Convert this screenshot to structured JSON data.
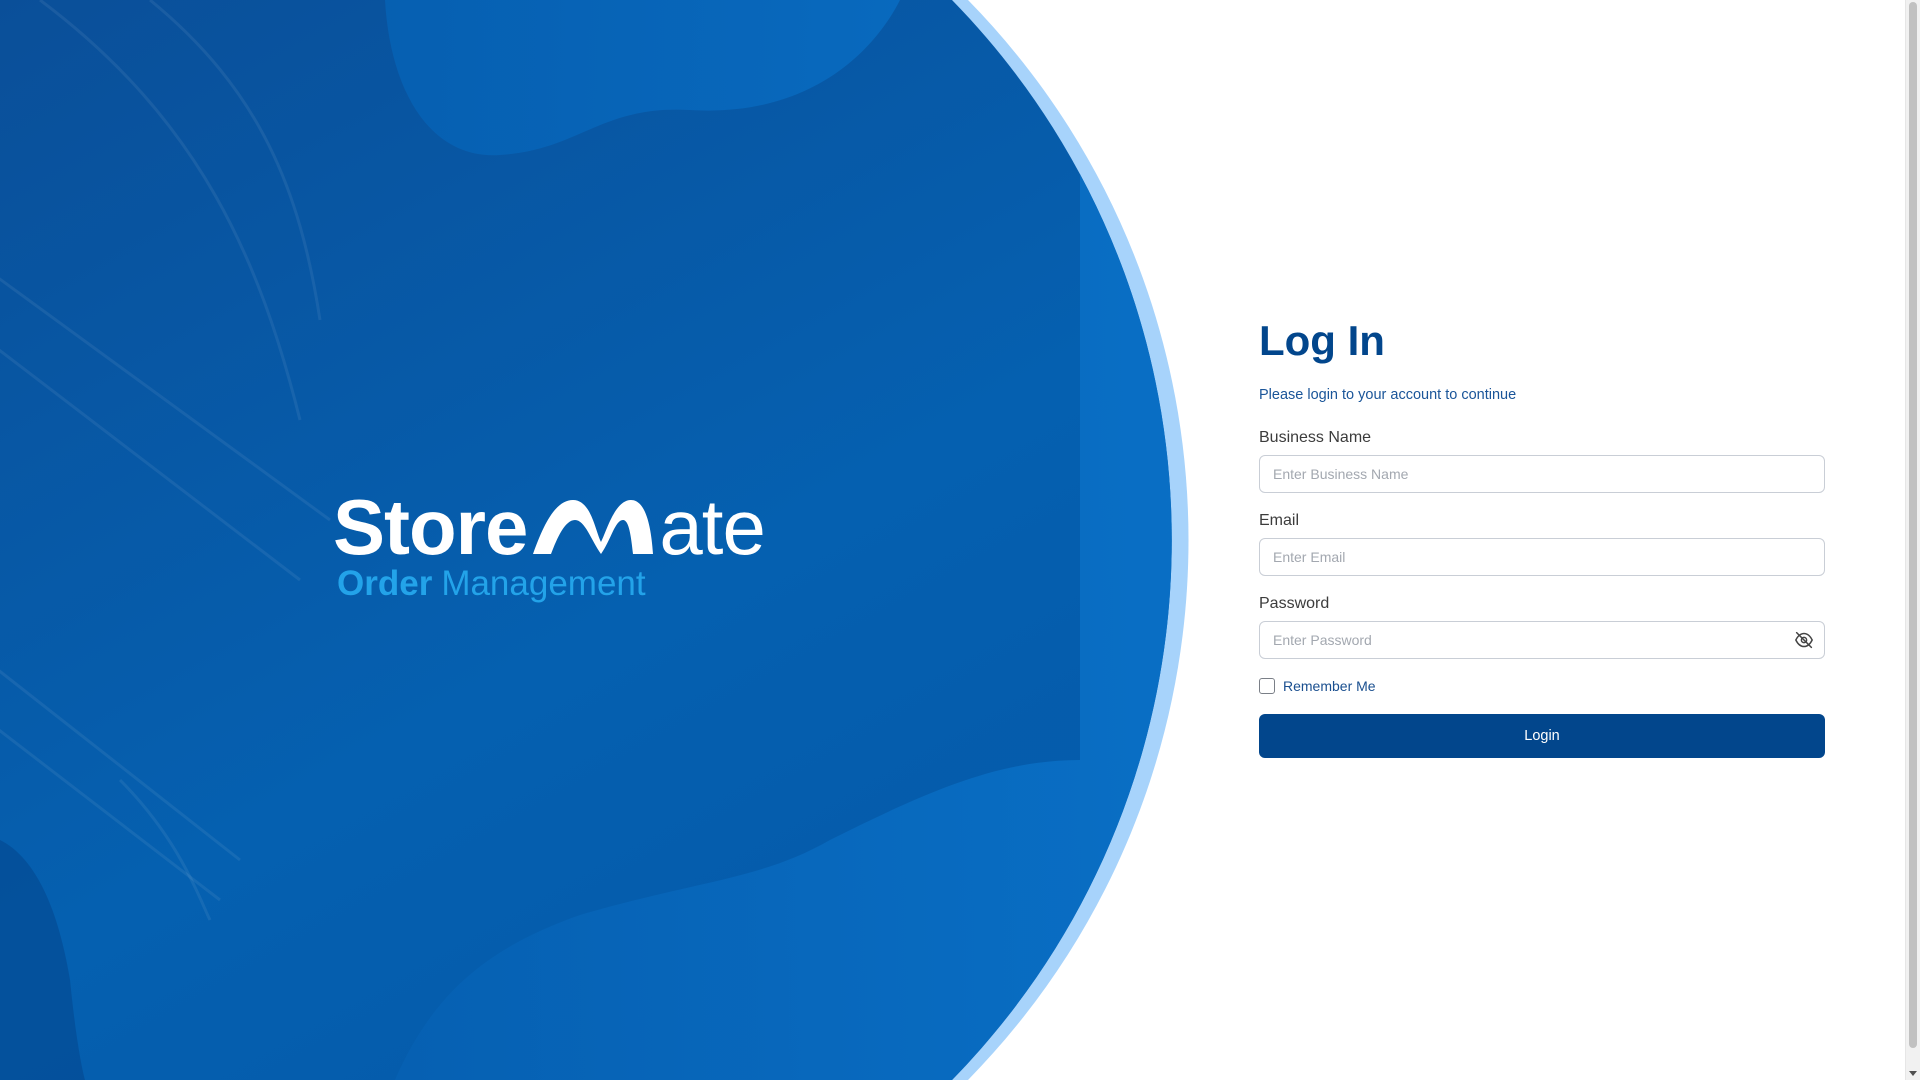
{
  "brand": {
    "logo_text": "StoreMate",
    "word_start": "Store",
    "word_end": "ate",
    "tagline_bold": "Order",
    "tagline_rest": "Management"
  },
  "login": {
    "title": "Log In",
    "subtitle": "Please login to your account to continue",
    "business_name": {
      "label": "Business Name",
      "placeholder": "Enter Business Name",
      "value": ""
    },
    "email": {
      "label": "Email",
      "placeholder": "Enter Email",
      "value": ""
    },
    "password": {
      "label": "Password",
      "placeholder": "Enter Password",
      "value": "",
      "toggle_icon": "eye-off-icon"
    },
    "remember_me": {
      "label": "Remember Me",
      "checked": false
    },
    "submit_label": "Login"
  },
  "colors": {
    "primary": "#02468c",
    "hero_blue": "#0a6ec7",
    "hero_dark": "#04488f",
    "hero_rim": "#9fd0fb",
    "tagline_accent": "#23a3e9"
  }
}
